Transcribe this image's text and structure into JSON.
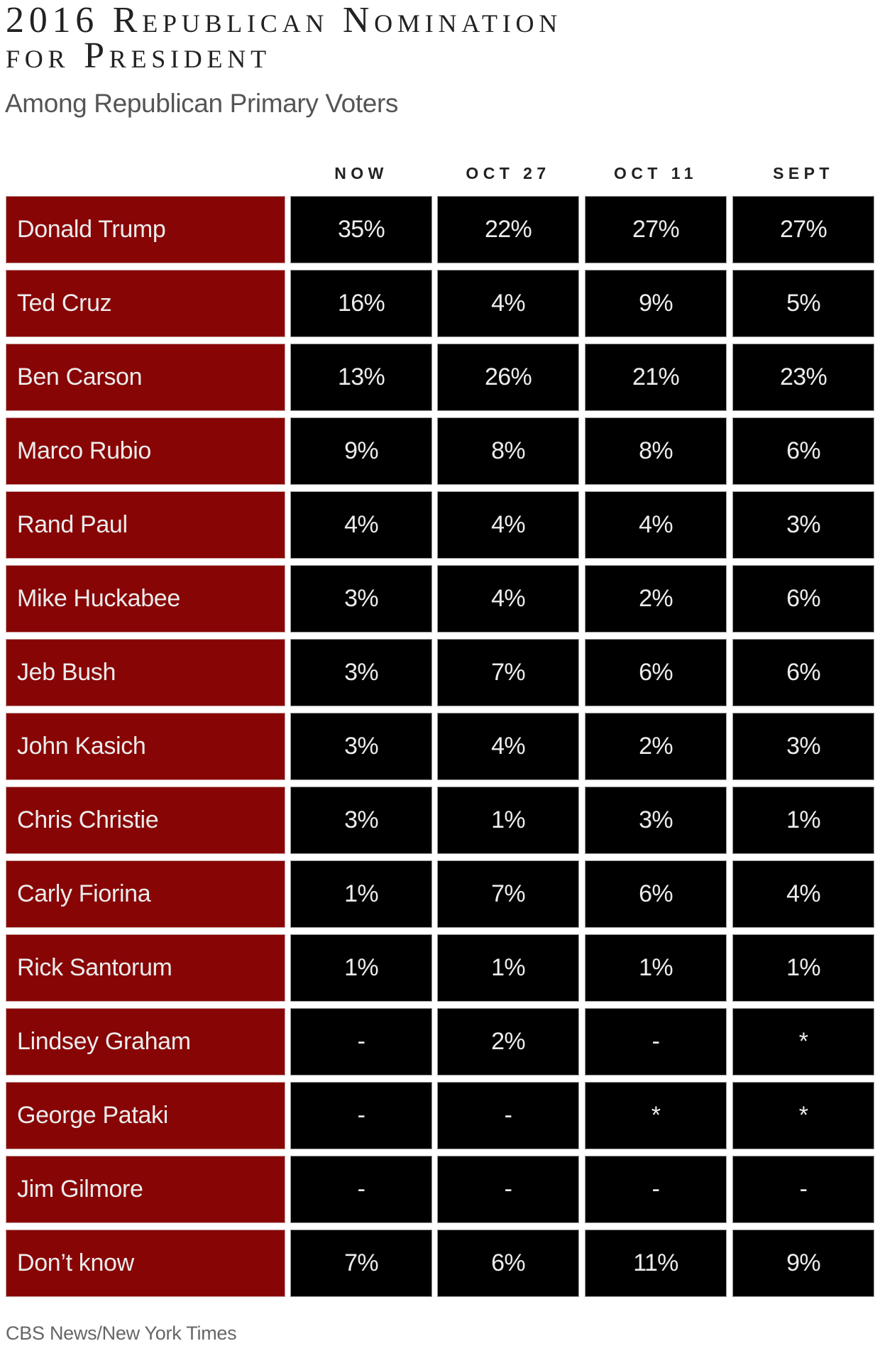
{
  "title_line1": "2016 Republican Nomination",
  "title_line2": "for President",
  "subtitle": "Among Republican Primary Voters",
  "source": "CBS News/New York Times",
  "colors": {
    "name_cell": "#880505",
    "value_cell": "#000000",
    "cell_text": "#ececec"
  },
  "chart_data": {
    "type": "table",
    "title": "2016 Republican Nomination for President",
    "subtitle": "Among Republican Primary Voters",
    "columns": [
      "NOW",
      "OCT 27",
      "OCT 11",
      "SEPT"
    ],
    "rows": [
      {
        "label": "Donald Trump",
        "values": [
          "35%",
          "22%",
          "27%",
          "27%"
        ]
      },
      {
        "label": "Ted Cruz",
        "values": [
          "16%",
          "4%",
          "9%",
          "5%"
        ]
      },
      {
        "label": "Ben Carson",
        "values": [
          "13%",
          "26%",
          "21%",
          "23%"
        ]
      },
      {
        "label": "Marco Rubio",
        "values": [
          "9%",
          "8%",
          "8%",
          "6%"
        ]
      },
      {
        "label": "Rand Paul",
        "values": [
          "4%",
          "4%",
          "4%",
          "3%"
        ]
      },
      {
        "label": "Mike Huckabee",
        "values": [
          "3%",
          "4%",
          "2%",
          "6%"
        ]
      },
      {
        "label": "Jeb Bush",
        "values": [
          "3%",
          "7%",
          "6%",
          "6%"
        ]
      },
      {
        "label": "John Kasich",
        "values": [
          "3%",
          "4%",
          "2%",
          "3%"
        ]
      },
      {
        "label": "Chris Christie",
        "values": [
          "3%",
          "1%",
          "3%",
          "1%"
        ]
      },
      {
        "label": "Carly Fiorina",
        "values": [
          "1%",
          "7%",
          "6%",
          "4%"
        ]
      },
      {
        "label": "Rick Santorum",
        "values": [
          "1%",
          "1%",
          "1%",
          "1%"
        ]
      },
      {
        "label": "Lindsey Graham",
        "values": [
          "-",
          "2%",
          "-",
          "*"
        ]
      },
      {
        "label": "George Pataki",
        "values": [
          "-",
          "-",
          "*",
          "*"
        ]
      },
      {
        "label": "Jim Gilmore",
        "values": [
          "-",
          "-",
          "-",
          "-"
        ]
      },
      {
        "label": "Don’t know",
        "values": [
          "7%",
          "6%",
          "11%",
          "9%"
        ]
      }
    ],
    "source": "CBS News/New York Times"
  }
}
